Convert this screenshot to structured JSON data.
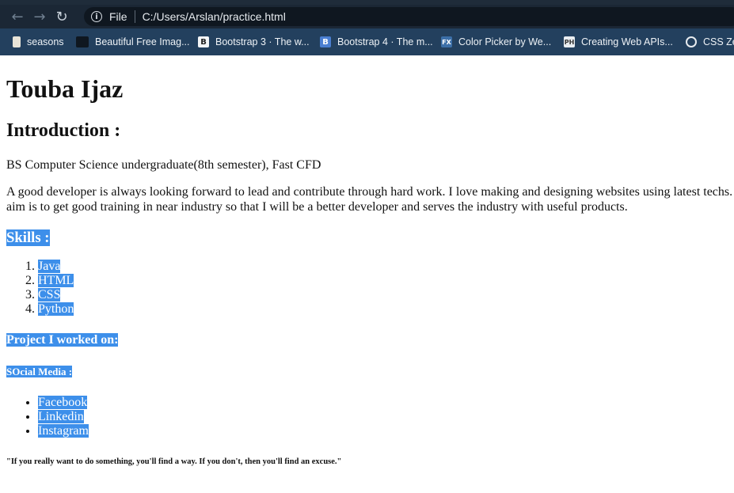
{
  "browser": {
    "nav": {
      "back": "←",
      "forward": "→",
      "reload": "↻"
    },
    "address": {
      "info": "i",
      "scheme": "File",
      "url": "C:/Users/Arslan/practice.html"
    },
    "bookmarks": [
      {
        "label": "seasons",
        "icon": "page-icon"
      },
      {
        "label": "Beautiful Free Imag...",
        "icon": "image-icon"
      },
      {
        "label": "Bootstrap 3 · The w...",
        "icon": "bootstrap-icon"
      },
      {
        "label": "Bootstrap 4 · The m...",
        "icon": "bootstrap-icon"
      },
      {
        "label": "Color Picker by We...",
        "icon": "fx-icon"
      },
      {
        "label": "Creating Web APIs...",
        "icon": "ph-icon"
      },
      {
        "label": "CSS Ze",
        "icon": "globe-icon"
      }
    ],
    "bookmark_icon_glyphs": [
      "",
      "",
      "B",
      "B",
      "FX",
      "PH",
      ""
    ]
  },
  "page": {
    "name": "Touba Ijaz",
    "intro_heading": "Introduction :",
    "education": "BS Computer Science undergraduate(8th semester), Fast CFD",
    "about": "A good developer is always looking forward to lead and contribute through hard work. I love making and designing websites using latest techs. aim is to get good training in near industry so that I will be a better developer and serves the industry with useful products.",
    "skills_heading": "Skills :",
    "skills": [
      "Java",
      "HTML",
      "CSS",
      "Python"
    ],
    "projects_heading": "Project I worked on:",
    "social_heading": "SOcial Media :",
    "social": [
      "Facebook",
      "Linkedin",
      "Instagram"
    ],
    "quote": "\"If you really want to do something, you'll find a way. If you don't, then you'll find an excuse.\""
  },
  "colors": {
    "selection": "#3d8fea",
    "toolbar": "#1b2735",
    "bookmarks_bar": "#23405e"
  }
}
